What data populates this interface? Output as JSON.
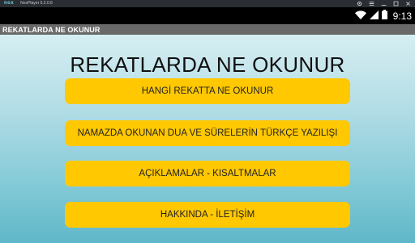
{
  "emulator": {
    "logo": "nox",
    "title": "NoxPlayer 5.2.0.6"
  },
  "status_bar": {
    "time": "9:13"
  },
  "action_bar": {
    "title": "REKATLARDA NE OKUNUR"
  },
  "main": {
    "heading": "REKATLARDA NE OKUNUR",
    "buttons": [
      {
        "label": "HANGİ REKATTA NE OKUNUR"
      },
      {
        "label": "NAMAZDA OKUNAN DUA VE SÜRELERİN TÜRKÇE YAZILIŞI"
      },
      {
        "label": "AÇIKLAMALAR - KISALTMALAR"
      },
      {
        "label": "HAKKINDA - İLETİŞİM"
      }
    ]
  },
  "colors": {
    "button": "#ffc800",
    "action_bar": "#696969",
    "status_bar": "#000000"
  }
}
